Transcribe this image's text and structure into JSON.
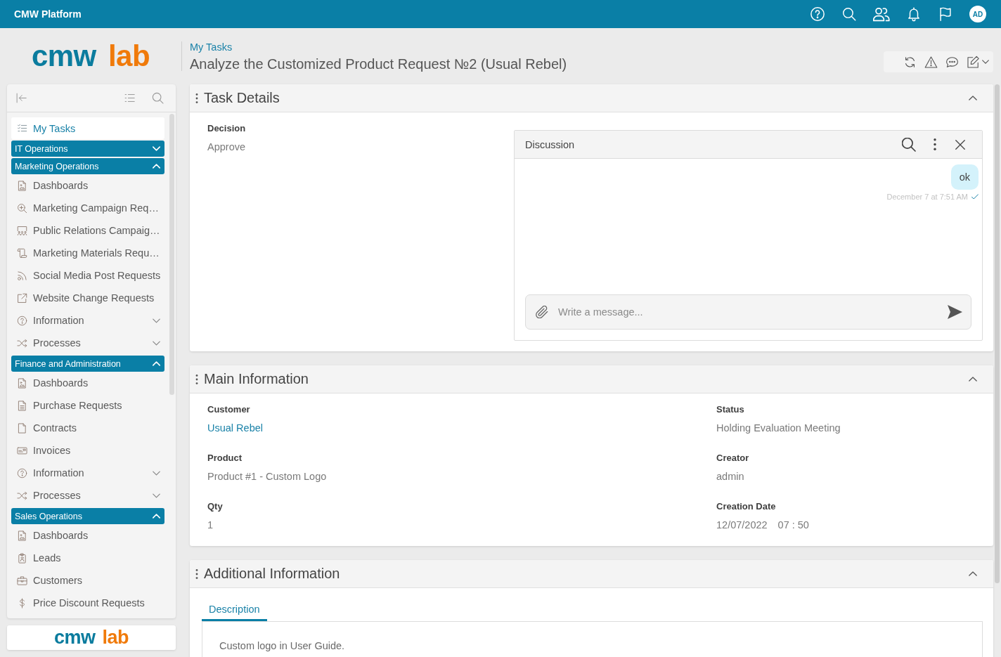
{
  "top_bar": {
    "title": "CMW Platform",
    "avatar_initials": "AD"
  },
  "header": {
    "logo": {
      "primary": "cmw",
      "accent": "lab"
    },
    "breadcrumb": "My Tasks",
    "title": "Analyze the Customized Product Request №2 (Usual Rebel)"
  },
  "sidebar": {
    "items": [
      {
        "kind": "link",
        "label": "My Tasks",
        "selected": true
      },
      {
        "kind": "group",
        "label": "IT Operations",
        "expanded": false
      },
      {
        "kind": "group",
        "label": "Marketing Operations",
        "expanded": true,
        "children": [
          {
            "kind": "page",
            "label": "Dashboards",
            "selected": false
          },
          {
            "kind": "page",
            "label": "Marketing Campaign Req…",
            "selected": false
          },
          {
            "kind": "page",
            "label": "Public Relations Campaig…",
            "selected": false
          },
          {
            "kind": "page",
            "label": "Marketing Materials Requ…",
            "selected": false
          },
          {
            "kind": "page",
            "label": "Social Media Post Requests",
            "selected": false
          },
          {
            "kind": "page",
            "label": "Website Change Requests",
            "selected": false
          },
          {
            "kind": "folder",
            "label": "Information",
            "selected": false,
            "expanded": false
          },
          {
            "kind": "folder",
            "label": "Processes",
            "selected": false,
            "expanded": false
          }
        ]
      },
      {
        "kind": "group",
        "label": "Finance and Administration",
        "expanded": true,
        "children": [
          {
            "kind": "page",
            "label": "Dashboards",
            "selected": false
          },
          {
            "kind": "page",
            "label": "Purchase Requests",
            "selected": false
          },
          {
            "kind": "page",
            "label": "Contracts",
            "selected": false
          },
          {
            "kind": "page",
            "label": "Invoices",
            "selected": false
          },
          {
            "kind": "folder",
            "label": "Information",
            "selected": false,
            "expanded": false
          },
          {
            "kind": "folder",
            "label": "Processes",
            "selected": false,
            "expanded": false
          }
        ]
      },
      {
        "kind": "group",
        "label": "Sales Operations",
        "expanded": true,
        "children": [
          {
            "kind": "page",
            "label": "Dashboards",
            "selected": false
          },
          {
            "kind": "page",
            "label": "Leads",
            "selected": false
          },
          {
            "kind": "page",
            "label": "Customers",
            "selected": false
          },
          {
            "kind": "page",
            "label": "Price Discount Requests",
            "selected": false
          }
        ]
      }
    ],
    "footer_logo": {
      "primary": "cmw",
      "accent": "lab"
    }
  },
  "task_details": {
    "title": "Task Details",
    "expanded": true,
    "decision": {
      "label": "Decision",
      "value": "Approve"
    },
    "discussion": {
      "title": "Discussion",
      "messages": [
        {
          "text": "ok",
          "time": "December 7 at 7:51 AM",
          "read": true
        }
      ],
      "input": {
        "placeholder": "Write a message..."
      }
    }
  },
  "main_information": {
    "title": "Main Information",
    "expanded": true,
    "fields": [
      {
        "label": "Customer",
        "value": "Usual Rebel",
        "kind": "link"
      },
      {
        "label": "Status",
        "value": "Holding Evaluation Meeting",
        "kind": "text"
      },
      {
        "label": "Product",
        "value": "Product #1 - Custom Logo",
        "kind": "text"
      },
      {
        "label": "Creator",
        "value": "admin",
        "kind": "text"
      },
      {
        "label": "Qty",
        "value": "1",
        "kind": "text"
      },
      {
        "label": "Creation Date",
        "value": "12/07/2022",
        "time": "07 : 50",
        "kind": "datetime"
      }
    ]
  },
  "additional_information": {
    "title": "Additional Information",
    "expanded": true,
    "tabs": [
      {
        "label": "Description",
        "selected": true
      }
    ],
    "description": "Custom logo in User Guide."
  }
}
